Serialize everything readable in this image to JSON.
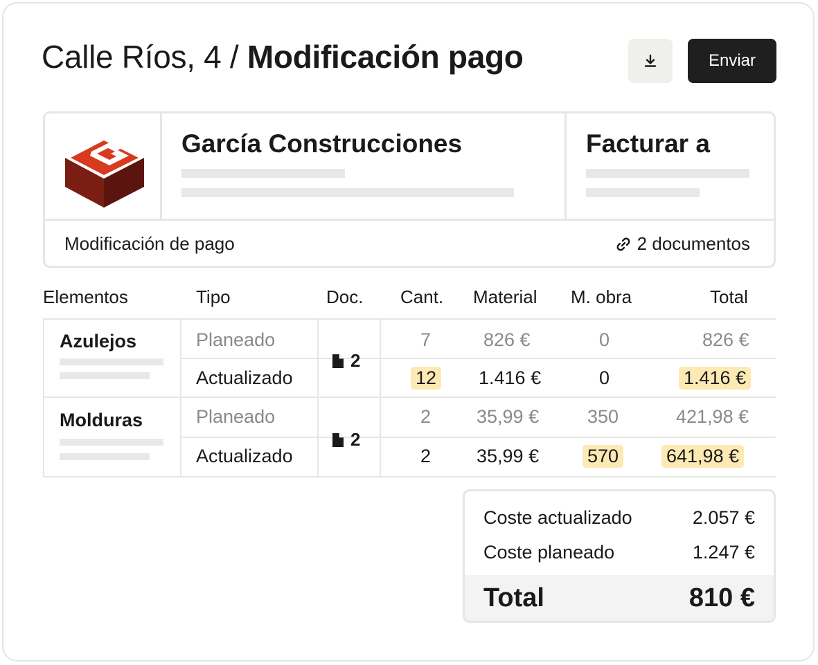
{
  "header": {
    "title_prefix": "Calle Ríos, 4 /",
    "title_main": "Modificación pago",
    "download_icon": "download-icon",
    "send_label": "Enviar"
  },
  "info": {
    "logo_icon": "company-logo-g-cube",
    "company": "García Construcciones",
    "bill_to": "Facturar a",
    "subtitle": "Modificación de pago",
    "link_icon": "link-icon",
    "documents": "2 documentos"
  },
  "table": {
    "headers": {
      "elements": "Elementos",
      "type": "Tipo",
      "doc": "Doc.",
      "qty": "Cant.",
      "material": "Material",
      "labor": "M. obra",
      "total": "Total"
    },
    "groups": [
      {
        "name": "Azulejos",
        "docs": "2",
        "rows": [
          {
            "type": "Planeado",
            "qty": "7",
            "material": "826 €",
            "labor": "0",
            "total": "826 €"
          },
          {
            "type": "Actualizado",
            "qty": "12",
            "material": "1.416 €",
            "labor": "0",
            "total": "1.416 €"
          }
        ]
      },
      {
        "name": "Molduras",
        "docs": "2",
        "rows": [
          {
            "type": "Planeado",
            "qty": "2",
            "material": "35,99 €",
            "labor": "350",
            "total": "421,98 €"
          },
          {
            "type": "Actualizado",
            "qty": "2",
            "material": "35,99 €",
            "labor": "570",
            "total": "641,98 €"
          }
        ]
      }
    ]
  },
  "summary": {
    "updated_label": "Coste actualizado",
    "updated_value": "2.057 €",
    "planned_label": "Coste planeado",
    "planned_value": "1.247 €",
    "total_label": "Total",
    "total_value": "810 €"
  },
  "colors": {
    "highlight": "#fde9b3",
    "logo_red": "#d83a1f",
    "logo_dark": "#6e1a12",
    "button_dark": "#1f1f1f"
  }
}
